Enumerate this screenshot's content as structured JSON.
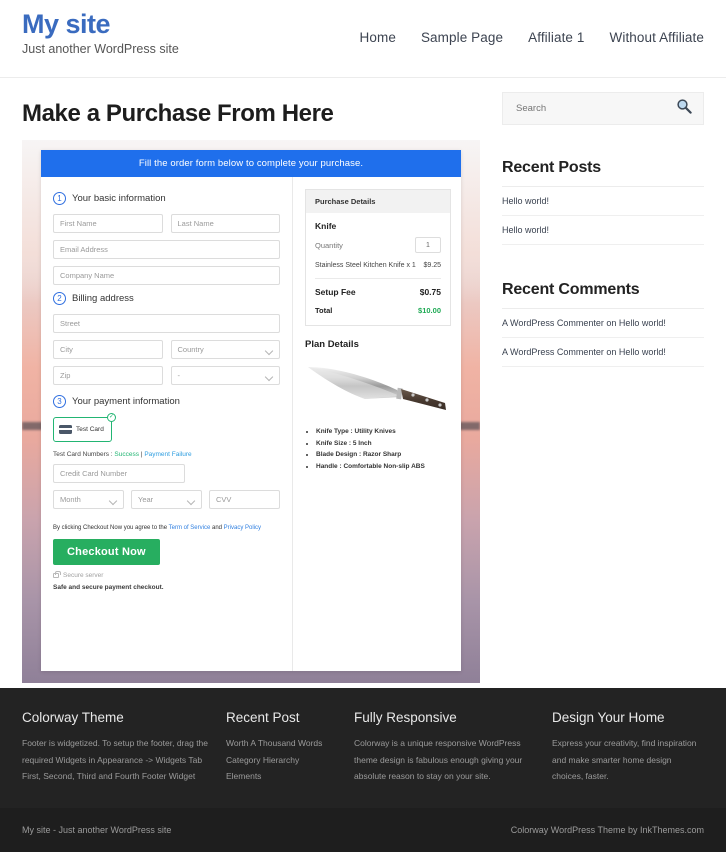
{
  "header": {
    "site_title": "My site",
    "site_description": "Just another WordPress site",
    "nav": [
      {
        "label": "Home"
      },
      {
        "label": "Sample Page"
      },
      {
        "label": "Affiliate 1"
      },
      {
        "label": "Without Affiliate"
      }
    ]
  },
  "main": {
    "page_title": "Make a Purchase From Here",
    "order_form": {
      "banner": "Fill the order form below to complete your purchase.",
      "steps": {
        "one_num": "1",
        "one_label": "Your basic information",
        "two_num": "2",
        "two_label": "Billing address",
        "three_num": "3",
        "three_label": "Your payment information"
      },
      "fields": {
        "first_name": "First Name",
        "last_name": "Last Name",
        "email": "Email Address",
        "company": "Company Name",
        "street": "Street",
        "city": "City",
        "country": "Country",
        "zip": "Zip",
        "state": "-",
        "credit_card": "Credit Card Number",
        "month": "Month",
        "year": "Year",
        "cvv": "CVV"
      },
      "payment": {
        "test_card_label": "Test Card",
        "test_numbers_prefix": "Test Card Numbers : ",
        "success_link": "Success",
        "separator": " | ",
        "failure_link": "Payment Failure",
        "terms_prefix": "By clicking Checkout Now you agree to the ",
        "terms_link": "Term of Service",
        "terms_mid": " and ",
        "privacy_link": "Privacy Policy",
        "checkout_button": "Checkout Now",
        "secure_server": "Secure server",
        "safe_note": "Safe and secure payment checkout."
      },
      "purchase_details": {
        "heading": "Purchase Details",
        "item_name": "Knife",
        "quantity_label": "Quantity",
        "quantity_value": "1",
        "line_item": "Stainless Steel Kitchen Knife x 1",
        "line_amount": "$9.25",
        "setup_label": "Setup Fee",
        "setup_amount": "$0.75",
        "total_label": "Total",
        "total_amount": "$10.00"
      },
      "plan_details": {
        "heading": "Plan Details",
        "bullets": [
          "Knife Type : Utility Knives",
          "Knife Size : 5 Inch",
          "Blade Design : Razor Sharp",
          "Handle : Comfortable Non-slip ABS"
        ]
      }
    }
  },
  "sidebar": {
    "search_placeholder": "Search",
    "recent_posts": {
      "title": "Recent Posts",
      "items": [
        {
          "label": "Hello world!"
        },
        {
          "label": "Hello world!"
        }
      ]
    },
    "recent_comments": {
      "title": "Recent Comments",
      "items": [
        {
          "label": "A WordPress Commenter on Hello world!"
        },
        {
          "label": "A WordPress Commenter on Hello world!"
        }
      ]
    }
  },
  "footer": {
    "columns": [
      {
        "title": "Colorway Theme",
        "text": "Footer is widgetized. To setup the footer, drag the required Widgets in Appearance -> Widgets Tab First, Second, Third and Fourth Footer Widget"
      },
      {
        "title": "Recent Post",
        "items": [
          {
            "label": "Worth A Thousand Words"
          },
          {
            "label": "Category Hierarchy"
          },
          {
            "label": "Elements"
          }
        ]
      },
      {
        "title": "Fully Responsive",
        "text": "Colorway is a unique responsive WordPress theme design is fabulous enough giving your absolute reason to stay on your site."
      },
      {
        "title": "Design Your Home",
        "text": "Express your creativity, find inspiration and make smarter home design choices, faster."
      }
    ],
    "bottom_left": "My site - Just another WordPress site",
    "bottom_right": "Colorway WordPress Theme by InkThemes.com"
  },
  "colors": {
    "brand_blue": "#3a6bbf",
    "banner_blue": "#1f6fec",
    "green": "#27ae60",
    "total_green": "#1faa55",
    "footer_dark": "#232323"
  }
}
